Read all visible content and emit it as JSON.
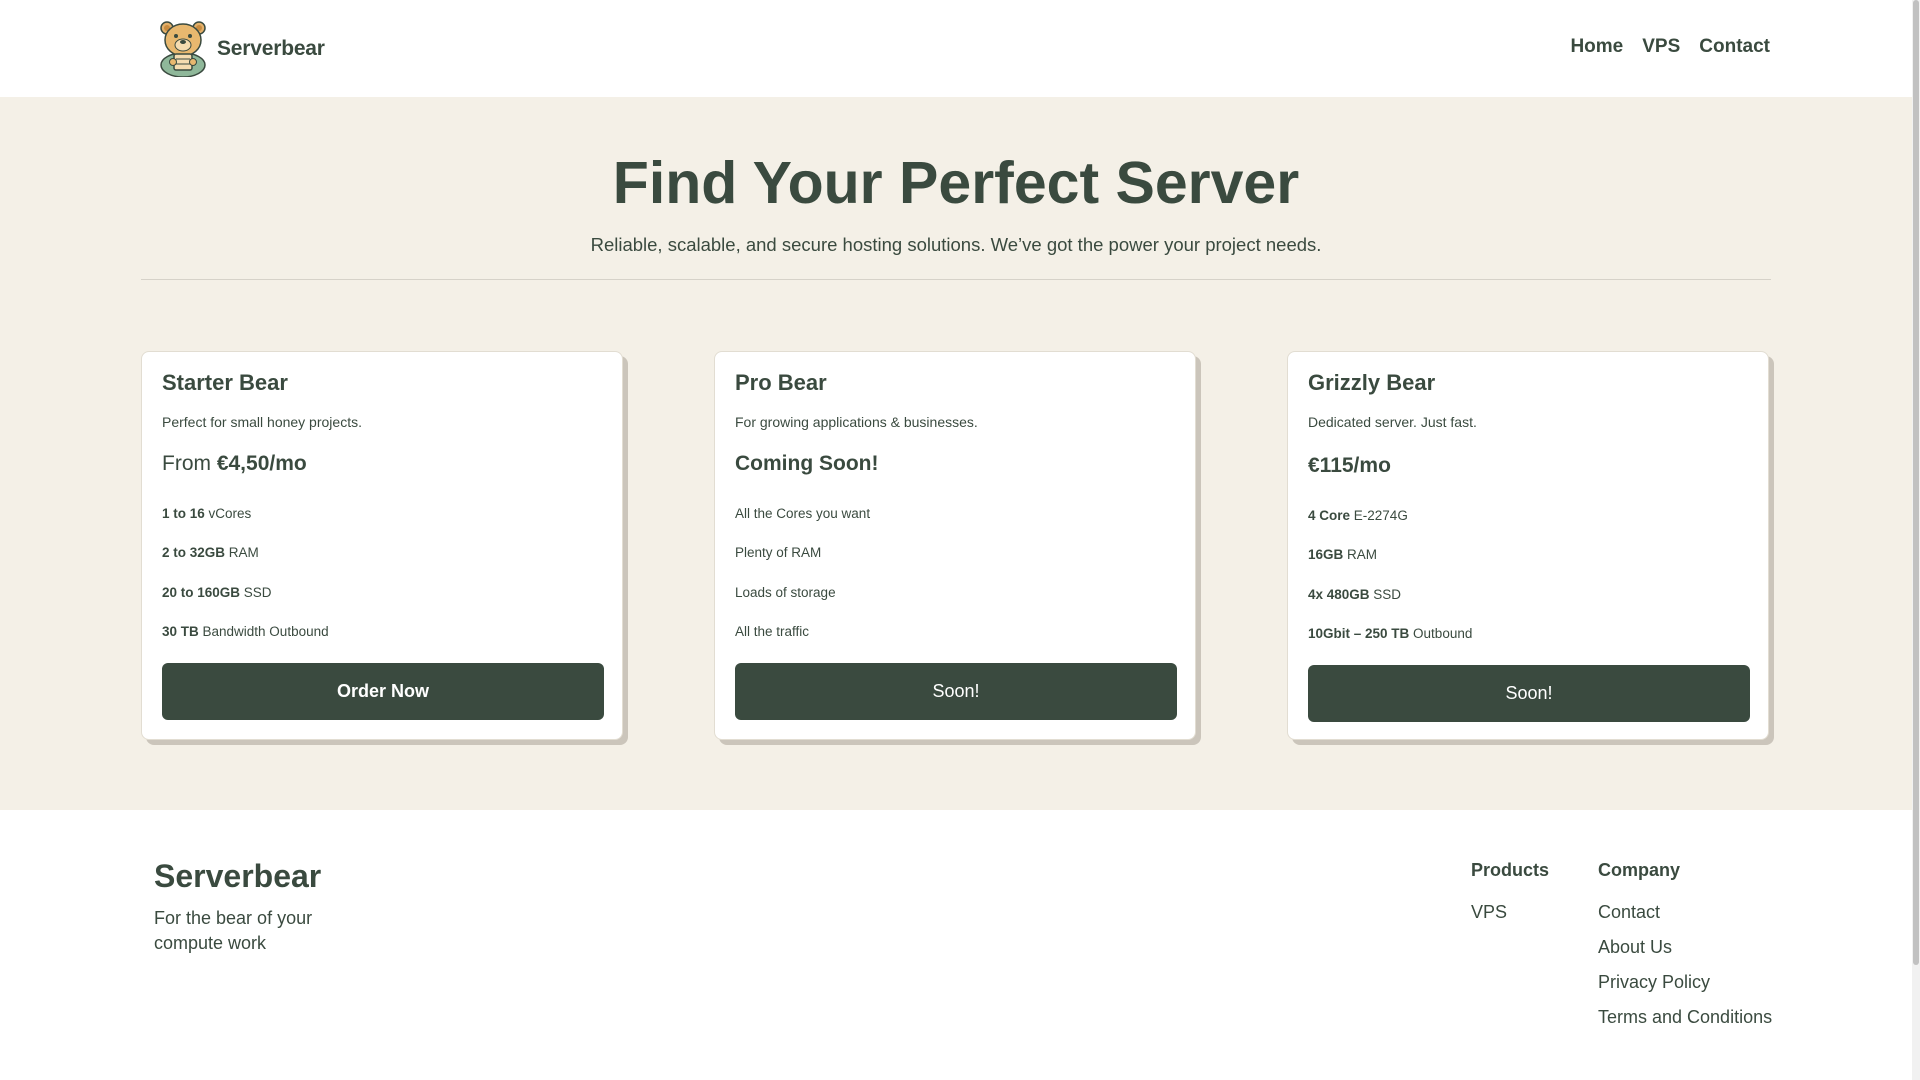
{
  "header": {
    "brand": "Serverbear",
    "nav": [
      "Home",
      "VPS",
      "Contact"
    ]
  },
  "hero": {
    "title": "Find Your Perfect Server",
    "subtitle": "Reliable, scalable, and secure hosting solutions. We’ve got the power your project needs."
  },
  "plans": [
    {
      "name": "Starter Bear",
      "description": "Perfect for small honey projects.",
      "price_prefix": "From ",
      "price": "€4,50/mo",
      "features": [
        {
          "bold": "1 to 16",
          "text": " vCores"
        },
        {
          "bold": "2 to 32GB",
          "text": " RAM"
        },
        {
          "bold": "20 to 160GB",
          "text": " SSD"
        },
        {
          "bold": "30 TB",
          "text": " Bandwidth Outbound"
        }
      ],
      "button": "Order Now"
    },
    {
      "name": "Pro Bear",
      "description": "For growing applications & businesses.",
      "price_prefix": "",
      "price": "Coming Soon!",
      "features": [
        {
          "bold": "",
          "text": "All the Cores you want"
        },
        {
          "bold": "",
          "text": "Plenty of RAM"
        },
        {
          "bold": "",
          "text": "Loads of storage"
        },
        {
          "bold": "",
          "text": "All the traffic"
        }
      ],
      "button": "Soon!"
    },
    {
      "name": "Grizzly Bear",
      "description": "Dedicated server. Just fast.",
      "price_prefix": "",
      "price": "€115/mo",
      "features": [
        {
          "bold": "4 Core",
          "text": " E-2274G"
        },
        {
          "bold": "16GB",
          "text": " RAM"
        },
        {
          "bold": "4x 480GB",
          "text": " SSD"
        },
        {
          "bold": "10Gbit – 250 TB",
          "text": " Outbound"
        }
      ],
      "button": "Soon!"
    }
  ],
  "footer": {
    "brand": "Serverbear",
    "tagline": "For the bear of your compute work",
    "products": {
      "heading": "Products",
      "links": [
        "VPS"
      ]
    },
    "company": {
      "heading": "Company",
      "links": [
        "Contact",
        "About Us",
        "Privacy Policy",
        "Terms and Conditions"
      ]
    }
  },
  "colors": {
    "primary": "#3a4a3f",
    "hero_bg": "#f4f0e7",
    "card_bg": "#ffffff",
    "shadow": "#cbc5bb"
  },
  "icons": {
    "logo": "bear-mascot-icon"
  }
}
